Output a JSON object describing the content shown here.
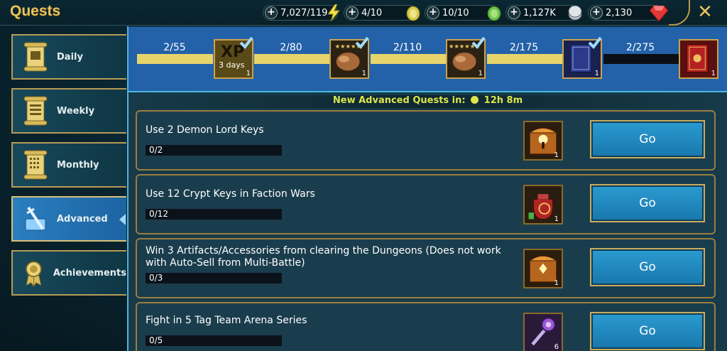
{
  "header": {
    "title": "Quests",
    "resources": [
      {
        "value": "7,027/119",
        "icon": "energy-icon"
      },
      {
        "value": "4/10",
        "icon": "arena-token-icon"
      },
      {
        "value": "10/10",
        "icon": "tag-arena-token-icon"
      },
      {
        "value": "1,127K",
        "icon": "silver-icon"
      },
      {
        "value": "2,130",
        "icon": "gem-icon"
      }
    ],
    "close": "✕"
  },
  "sidebar": {
    "items": [
      {
        "label": "Daily",
        "icon": "scroll-icon"
      },
      {
        "label": "Weekly",
        "icon": "scroll-icon"
      },
      {
        "label": "Monthly",
        "icon": "scroll-icon"
      },
      {
        "label": "Advanced",
        "icon": "sword-icon",
        "active": true
      },
      {
        "label": "Achievements",
        "icon": "medal-icon"
      }
    ]
  },
  "progress": {
    "milestones": [
      {
        "label": "2/55",
        "reward": "XP boost",
        "reward_text": "XP",
        "reward_sub": "3 days",
        "qty": "1",
        "claimed": true
      },
      {
        "label": "2/80",
        "reward": "chicken",
        "qty": "1",
        "claimed": true
      },
      {
        "label": "2/110",
        "reward": "chicken",
        "qty": "1",
        "claimed": true
      },
      {
        "label": "2/175",
        "reward": "tome",
        "qty": "1",
        "claimed": true
      },
      {
        "label": "2/275",
        "reward": "sacred tome",
        "qty": "1",
        "claimed": false
      }
    ]
  },
  "new_quests": {
    "label": "New Advanced Quests in:",
    "time": "12h 8m"
  },
  "quests": [
    {
      "title": "Use 2 Demon Lord Keys",
      "progress": "0/2",
      "reward": "demon-lord-key-chest-icon",
      "qty": "1",
      "go": "Go"
    },
    {
      "title": "Use 12 Crypt Keys in Faction Wars",
      "progress": "0/12",
      "reward": "crypt-loot-bag-icon",
      "qty": "1",
      "go": "Go"
    },
    {
      "title": "Win 3 Artifacts/Accessories from clearing the Dungeons (Does not work with Auto-Sell from Multi-Battle)",
      "progress": "0/3",
      "reward": "artifact-chest-icon",
      "qty": "1",
      "go": "Go"
    },
    {
      "title": "Fight in 5 Tag Team Arena Series",
      "progress": "0/5",
      "reward": "mace-icon",
      "qty": "6",
      "go": "Go"
    }
  ],
  "colors": {
    "accent": "#e8c35a",
    "bar_fill": "#e7d56b",
    "timer_text": "#d9e44c",
    "go_button": "#1e86bd"
  }
}
